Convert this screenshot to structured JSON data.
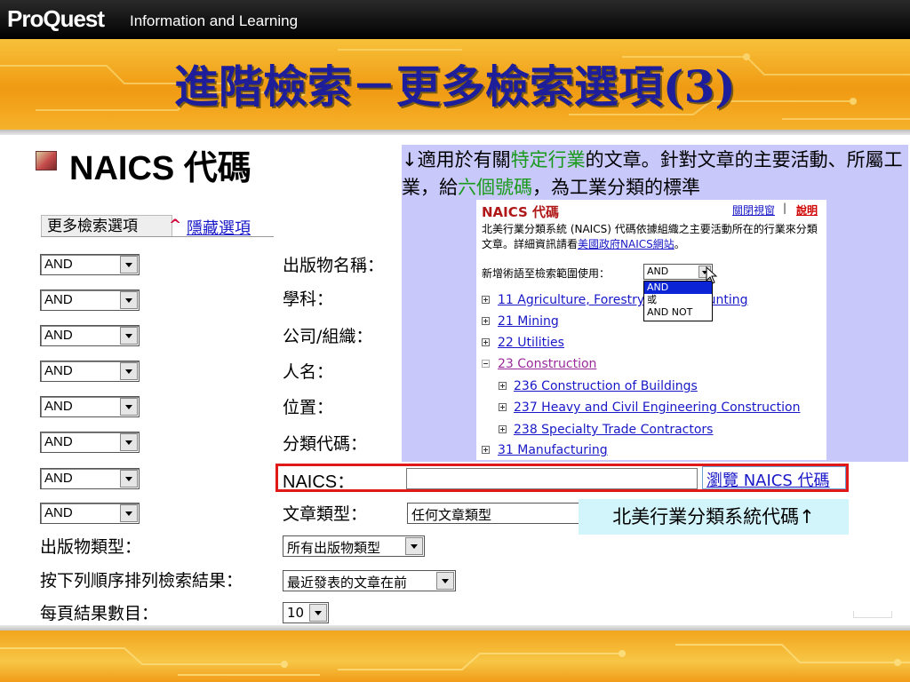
{
  "header": {
    "brand": "ProQuest",
    "brand_sub": "Information and Learning",
    "title": "進階檢索－更多檢索選項(3)"
  },
  "section": {
    "heading": "NAICS 代碼"
  },
  "left_form": {
    "tab_label": "更多檢索選項",
    "hide_link": "隱藏選項",
    "operators": [
      "AND",
      "AND",
      "AND",
      "AND",
      "AND",
      "AND",
      "AND",
      "AND"
    ],
    "field_labels": [
      "出版物名稱：",
      "學科：",
      "公司/組織：",
      "人名：",
      "位置：",
      "分類代碼："
    ],
    "naics_label": "NAICS：",
    "naics_value": "",
    "browse_link": "瀏覽 NAICS 代碼",
    "doc_type_label": "文章類型：",
    "doc_type_value": "任何文章類型",
    "pub_type_label": "出版物類型：",
    "pub_type_value": "所有出版物類型",
    "sort_label": "按下列順序排列檢索結果：",
    "sort_value": "最近發表的文章在前",
    "per_page_label": "每頁結果數目：",
    "per_page_value": "10"
  },
  "note": {
    "part1": "↓適用於有關",
    "highlight1": "特定行業",
    "part2": "的文章。針對文章的主要活動、所屬工業，給",
    "highlight2": "六個號碼",
    "part3": "，為工業分類的標準"
  },
  "popup": {
    "title": "NAICS 代碼",
    "close_link": "關閉視窗",
    "separator": "|",
    "help_link": "說明",
    "desc_prefix": "北美行業分類系統 (NAICS) 代碼依據組織之主要活動所在的行業來分類文章。詳細資訊請看",
    "desc_link": "美國政府NAICS網站",
    "desc_suffix": "。",
    "add_label": "新增術語至檢索範圍使用：",
    "add_value": "AND",
    "dropdown_options": [
      "AND",
      "或",
      "AND NOT"
    ],
    "tree": [
      {
        "label": "11 Agriculture, Forestry, F",
        "tail": "Hunting"
      },
      {
        "label": "21 Mining"
      },
      {
        "label": "22 Utilities"
      },
      {
        "label": "23 Construction"
      },
      {
        "label": "236 Construction of Buildings"
      },
      {
        "label": "237 Heavy and Civil Engineering Construction"
      },
      {
        "label": "238 Specialty Trade Contractors"
      },
      {
        "label": "31 Manufacturing"
      }
    ]
  },
  "callout": "北美行業分類系統代碼↑",
  "colors": {
    "title_blue": "#1e1e9a",
    "link_blue": "#1818c8",
    "highlight_green": "#1a9a1a",
    "panel_purple": "#c8c8fa",
    "red_outline": "#e01818",
    "callout_cyan": "#d2f4fb"
  }
}
